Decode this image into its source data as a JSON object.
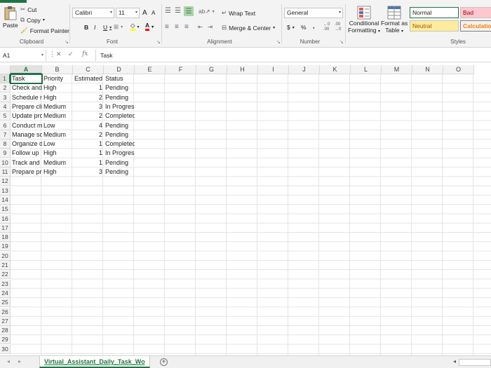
{
  "ribbon": {
    "clipboard": {
      "paste": "Paste",
      "cut": "Cut",
      "copy": "Copy",
      "format_painter": "Format Painter",
      "label": "Clipboard"
    },
    "font": {
      "name": "Calibri",
      "size": "11",
      "label": "Font",
      "bold": "B",
      "italic": "I",
      "underline": "U",
      "grow": "A",
      "shrink": "A",
      "font_color": "A"
    },
    "alignment": {
      "wrap_text": "Wrap Text",
      "merge_center": "Merge & Center",
      "label": "Alignment"
    },
    "number": {
      "format": "General",
      "currency": "$",
      "percent": "%",
      "comma": ",",
      "label": "Number"
    },
    "styles": {
      "conditional_formatting_1": "Conditional",
      "conditional_formatting_2": "Formatting",
      "format_as_table_1": "Format as",
      "format_as_table_2": "Table",
      "normal": "Normal",
      "bad": "Bad",
      "neutral": "Neutral",
      "calculation": "Calculation",
      "label": "Styles",
      "colors": {
        "bad_bg": "#ffc7ce",
        "bad_fg": "#9c0006",
        "neutral_bg": "#ffeb9c",
        "neutral_fg": "#9c5700",
        "calc_fg": "#fa7d00"
      }
    }
  },
  "formula_bar": {
    "name_box": "A1",
    "fx": "fx",
    "content": "Task"
  },
  "columns": [
    "A",
    "B",
    "C",
    "D",
    "E",
    "F",
    "G",
    "H",
    "I",
    "J",
    "K",
    "L",
    "M",
    "N",
    "O"
  ],
  "rows": [
    "1",
    "2",
    "3",
    "4",
    "5",
    "6",
    "7",
    "8",
    "9",
    "10",
    "11",
    "12",
    "13",
    "14",
    "15",
    "16",
    "17",
    "18",
    "19",
    "20",
    "21",
    "22",
    "23",
    "24",
    "25",
    "26",
    "27",
    "28",
    "29",
    "30"
  ],
  "table": {
    "headers": [
      "Task",
      "Priority",
      "Estimated",
      "Status"
    ],
    "rows": [
      [
        "Check and",
        "High",
        "1",
        "Pending"
      ],
      [
        "Schedule n",
        "High",
        "2",
        "Pending"
      ],
      [
        "Prepare cli",
        "Medium",
        "3",
        "In Progress"
      ],
      [
        "Update pro",
        "Medium",
        "2",
        "Completed"
      ],
      [
        "Conduct m",
        "Low",
        "4",
        "Pending"
      ],
      [
        "Manage so",
        "Medium",
        "2",
        "Pending"
      ],
      [
        "Organize d",
        "Low",
        "1",
        "Completed"
      ],
      [
        "Follow up",
        "High",
        "1",
        "In Progress"
      ],
      [
        "Track and",
        "Medium",
        "1",
        "Pending"
      ],
      [
        "Prepare pr",
        "High",
        "3",
        "Pending"
      ]
    ]
  },
  "sheet_tab": "Virtual_Assistant_Daily_Task_Wo",
  "accent": "#217346"
}
